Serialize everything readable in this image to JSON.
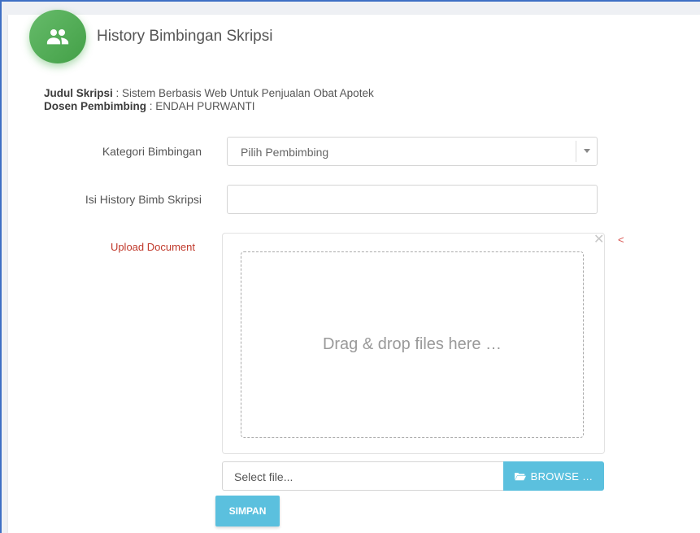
{
  "header": {
    "title": "History Bimbingan Skripsi",
    "icon": "people-icon",
    "icon_color": "#4caf50"
  },
  "info": {
    "judul_label": "Judul Skripsi",
    "judul_value": " : Sistem Berbasis Web Untuk Penjualan Obat Apotek",
    "dosen_label": "Dosen Pembimbing",
    "dosen_value": " : ENDAH PURWANTI"
  },
  "form": {
    "kategori_label": "Kategori Bimbingan",
    "kategori_selected": "Pilih Pembimbing",
    "isi_label": "Isi History Bimb Skripsi",
    "isi_value": "",
    "upload_label": "Upload Document",
    "upload_marker": "<",
    "dropzone_text": "Drag & drop files here …",
    "file_caption": "Select file...",
    "browse_label": "BROWSE …",
    "submit_label": "SIMPAN"
  },
  "colors": {
    "accent": "#5bc0de",
    "upload_label": "#c0392b",
    "frame": "#3e6fc4"
  }
}
